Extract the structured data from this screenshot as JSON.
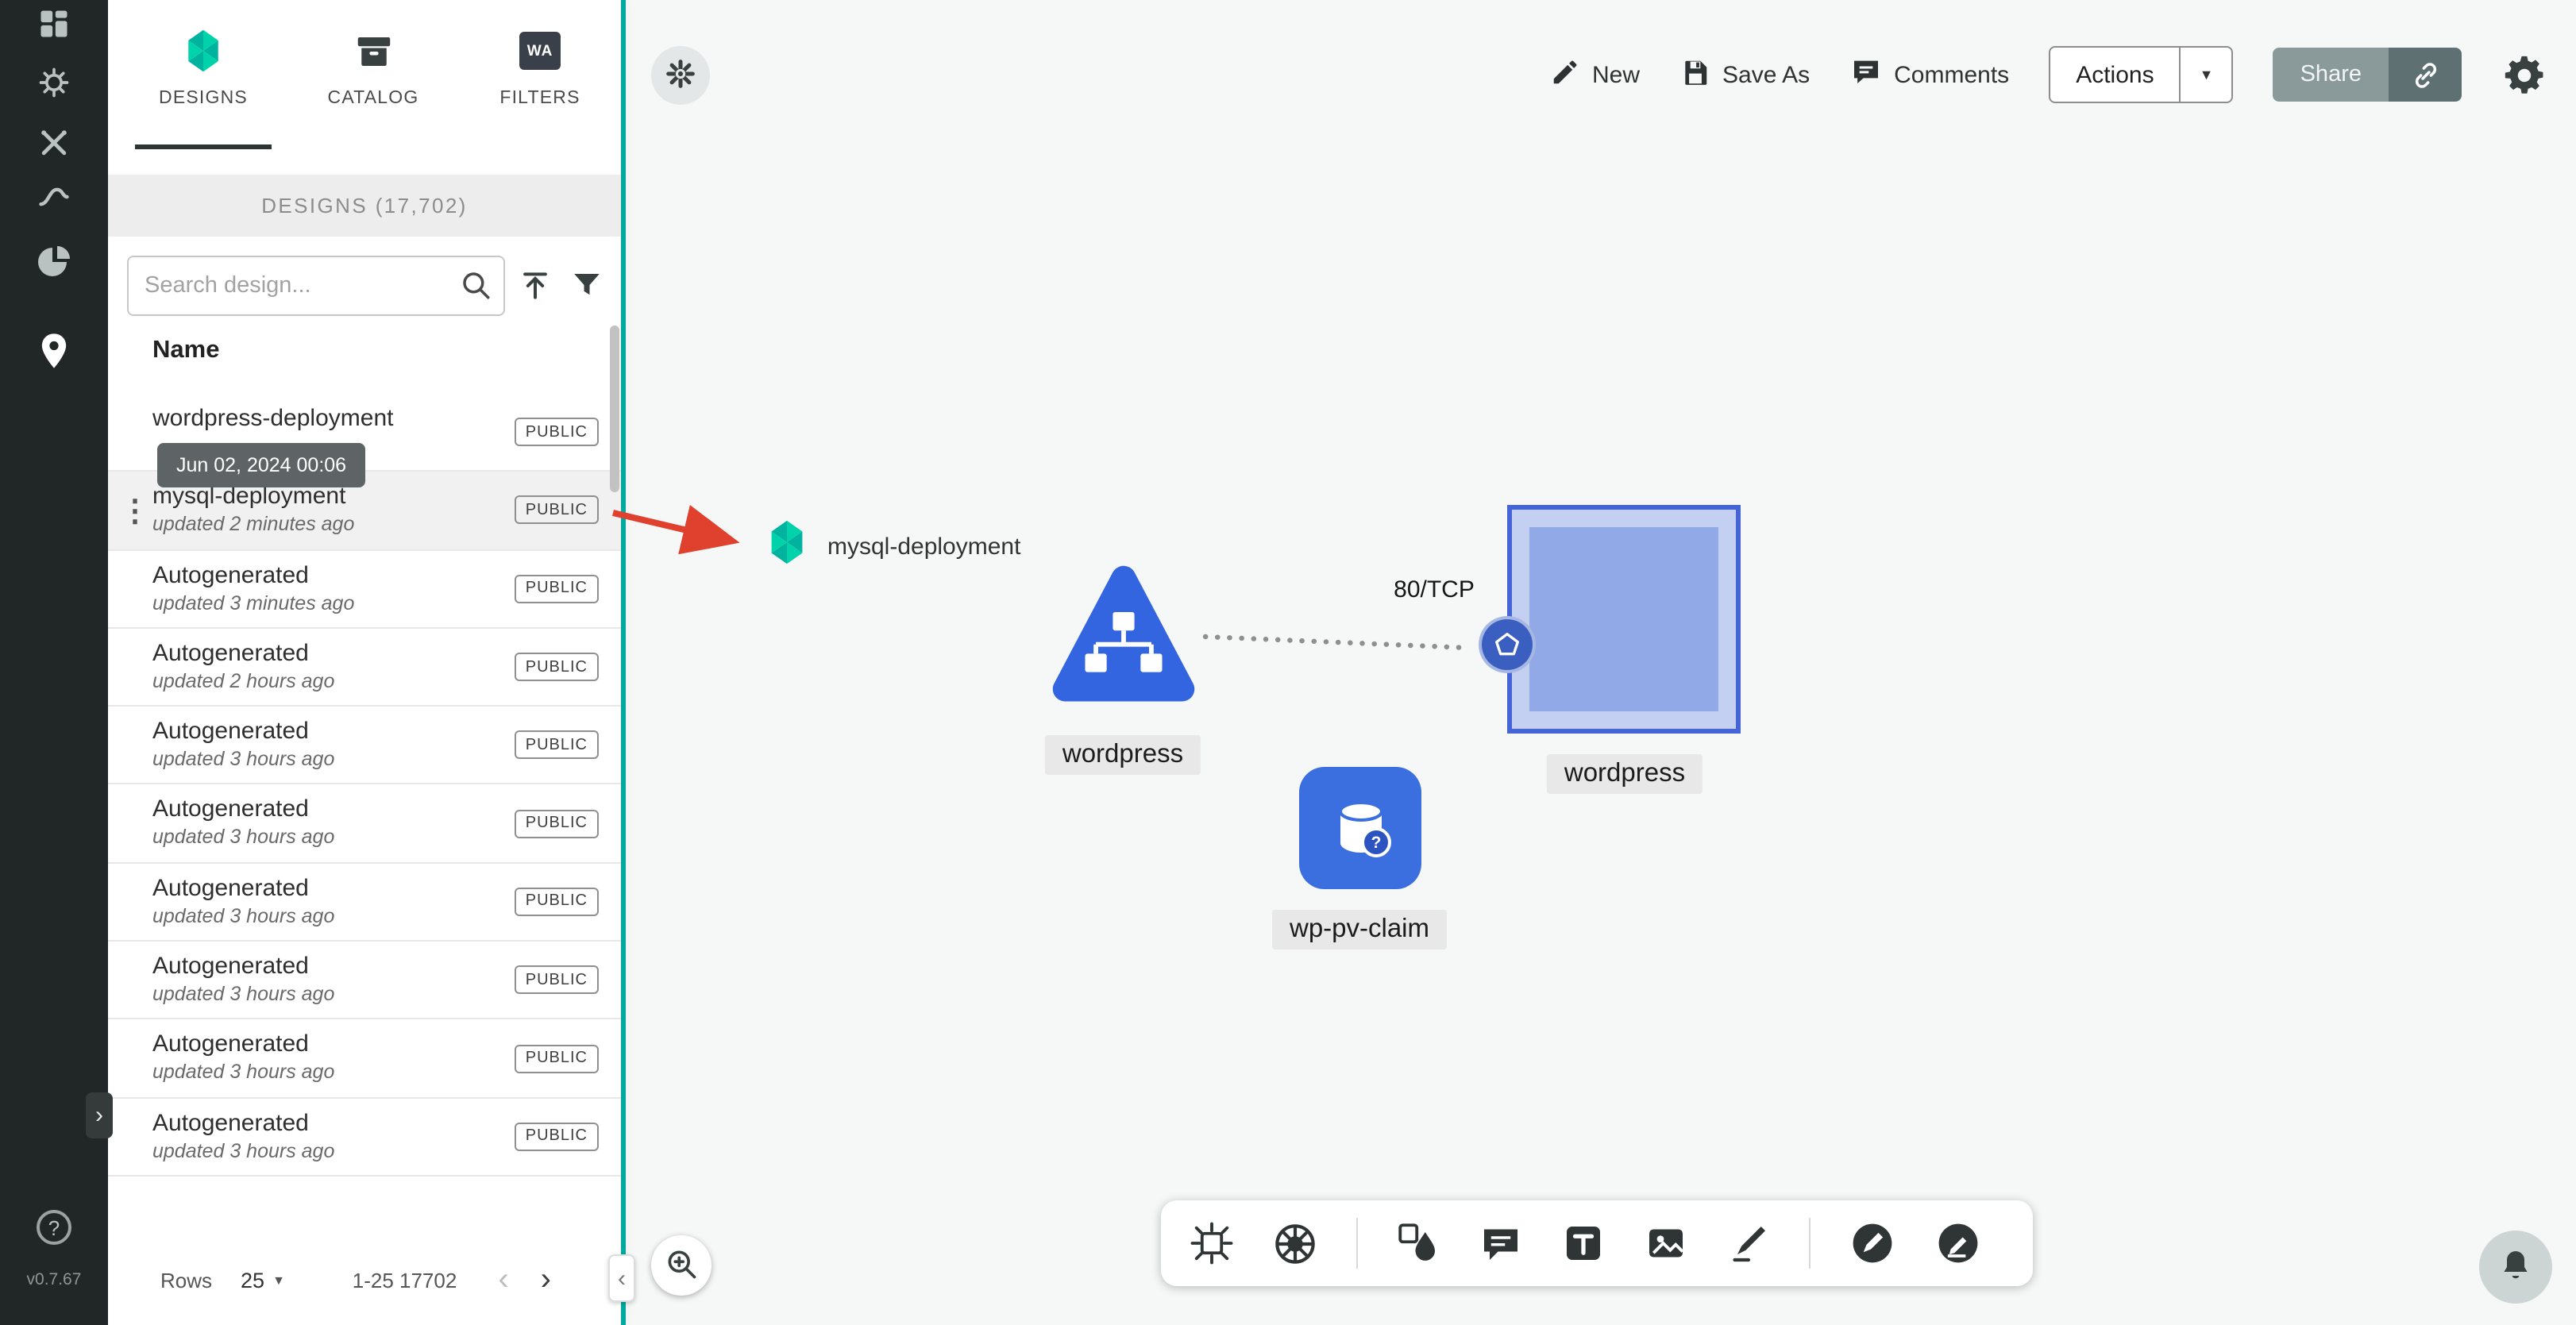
{
  "colors": {
    "brand_teal": "#00A99D",
    "kubernetes_blue": "#3265DF",
    "arrow_red": "#E0412F",
    "rail_dark": "#212726",
    "selected_border": "#4565D6",
    "selected_fill": "#92A9E8"
  },
  "rail": {
    "icons": [
      "dashboard-icon",
      "lifecycle-icon",
      "configuration-icon",
      "performance-icon",
      "extensions-icon",
      "kanvas-pin-icon"
    ],
    "help": "?",
    "version": "v0.7.67"
  },
  "glyphs": {
    "kebab": "⋮",
    "chevron_left": "‹",
    "chevron_right": "›",
    "caret_down": "▼",
    "expand_right": "›",
    "collapse_left": "‹"
  },
  "panel": {
    "tabs": [
      {
        "label": "DESIGNS"
      },
      {
        "label": "CATALOG"
      },
      {
        "label": "FILTERS"
      }
    ],
    "active_tab": "DESIGNS",
    "filters_wa": "WA",
    "header": "DESIGNS (17,702)",
    "search": {
      "placeholder": "Search design..."
    },
    "columns": {
      "name": "Name"
    },
    "tooltip": "Jun 02, 2024 00:06",
    "rows": [
      {
        "name": "wordpress-deployment",
        "updated": "",
        "badge": "PUBLIC"
      },
      {
        "name": "mysql-deployment",
        "updated": "updated 2 minutes ago",
        "badge": "PUBLIC"
      },
      {
        "name": "Autogenerated",
        "updated": "updated 3 minutes ago",
        "badge": "PUBLIC"
      },
      {
        "name": "Autogenerated",
        "updated": "updated 2 hours ago",
        "badge": "PUBLIC"
      },
      {
        "name": "Autogenerated",
        "updated": "updated 3 hours ago",
        "badge": "PUBLIC"
      },
      {
        "name": "Autogenerated",
        "updated": "updated 3 hours ago",
        "badge": "PUBLIC"
      },
      {
        "name": "Autogenerated",
        "updated": "updated 3 hours ago",
        "badge": "PUBLIC"
      },
      {
        "name": "Autogenerated",
        "updated": "updated 3 hours ago",
        "badge": "PUBLIC"
      },
      {
        "name": "Autogenerated",
        "updated": "updated 3 hours ago",
        "badge": "PUBLIC"
      },
      {
        "name": "Autogenerated",
        "updated": "updated 3 hours ago",
        "badge": "PUBLIC"
      }
    ],
    "footer": {
      "rows_label": "Rows",
      "page_size": "25",
      "range": "1-25 17702"
    }
  },
  "topbar": {
    "new": "New",
    "save_as": "Save As",
    "comments": "Comments",
    "actions": "Actions",
    "share": "Share"
  },
  "canvas": {
    "drag_item": "mysql-deployment",
    "edge": {
      "label": "80/TCP"
    },
    "nodes": {
      "deployment": {
        "label": "wordpress"
      },
      "service_target": {
        "label": "wordpress"
      },
      "pvc": {
        "label": "wp-pv-claim",
        "badge": "?"
      }
    },
    "toolbar_icons": [
      "component-icon",
      "kubernetes-icon",
      "shapes-icon",
      "comment-tool-icon",
      "text-tool-icon",
      "media-icon",
      "pen-tool-icon",
      "draw-circle-icon",
      "annotate-circle-icon"
    ]
  }
}
